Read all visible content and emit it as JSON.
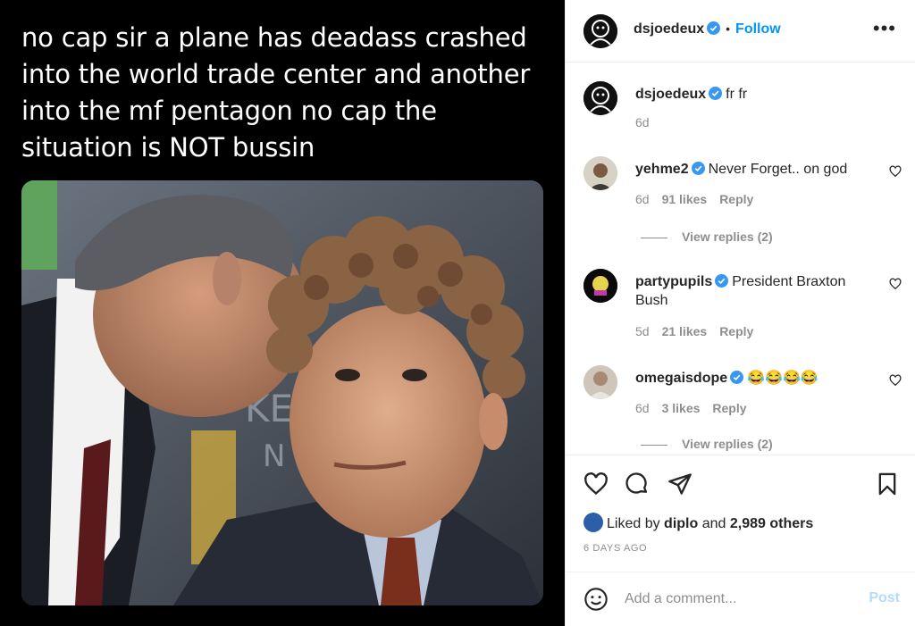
{
  "meme": {
    "caption": "no cap sir a plane has deadass crashed into the world trade center and another into the mf pentagon no cap the situation is NOT bussin"
  },
  "post": {
    "author": "dsjoedeux",
    "follow_label": "Follow",
    "separator": "•",
    "more_icon": "more-options-icon",
    "caption_comment": {
      "user": "dsjoedeux",
      "text": "fr fr",
      "age": "6d"
    }
  },
  "comments": [
    {
      "user": "yehme2",
      "text": "Never Forget.. on god",
      "age": "6d",
      "likes": "91 likes",
      "reply": "Reply",
      "view_replies": "View replies (2)"
    },
    {
      "user": "partypupils",
      "text": "President Braxton Bush",
      "age": "5d",
      "likes": "21 likes",
      "reply": "Reply"
    },
    {
      "user": "omegaisdope",
      "text": "😂😂😂😂",
      "age": "6d",
      "likes": "3 likes",
      "reply": "Reply",
      "view_replies": "View replies (2)"
    }
  ],
  "actions": {
    "liked_prefix": "Liked by ",
    "liked_user": "diplo",
    "liked_mid": " and ",
    "liked_count": "2,989 others",
    "timestamp": "6 DAYS AGO"
  },
  "add_comment": {
    "placeholder": "Add a comment...",
    "post_label": "Post"
  },
  "colors": {
    "accent": "#0095f6",
    "verified": "#3897f0",
    "post_disabled": "#b3dbff",
    "muted": "#8e8e8e"
  }
}
